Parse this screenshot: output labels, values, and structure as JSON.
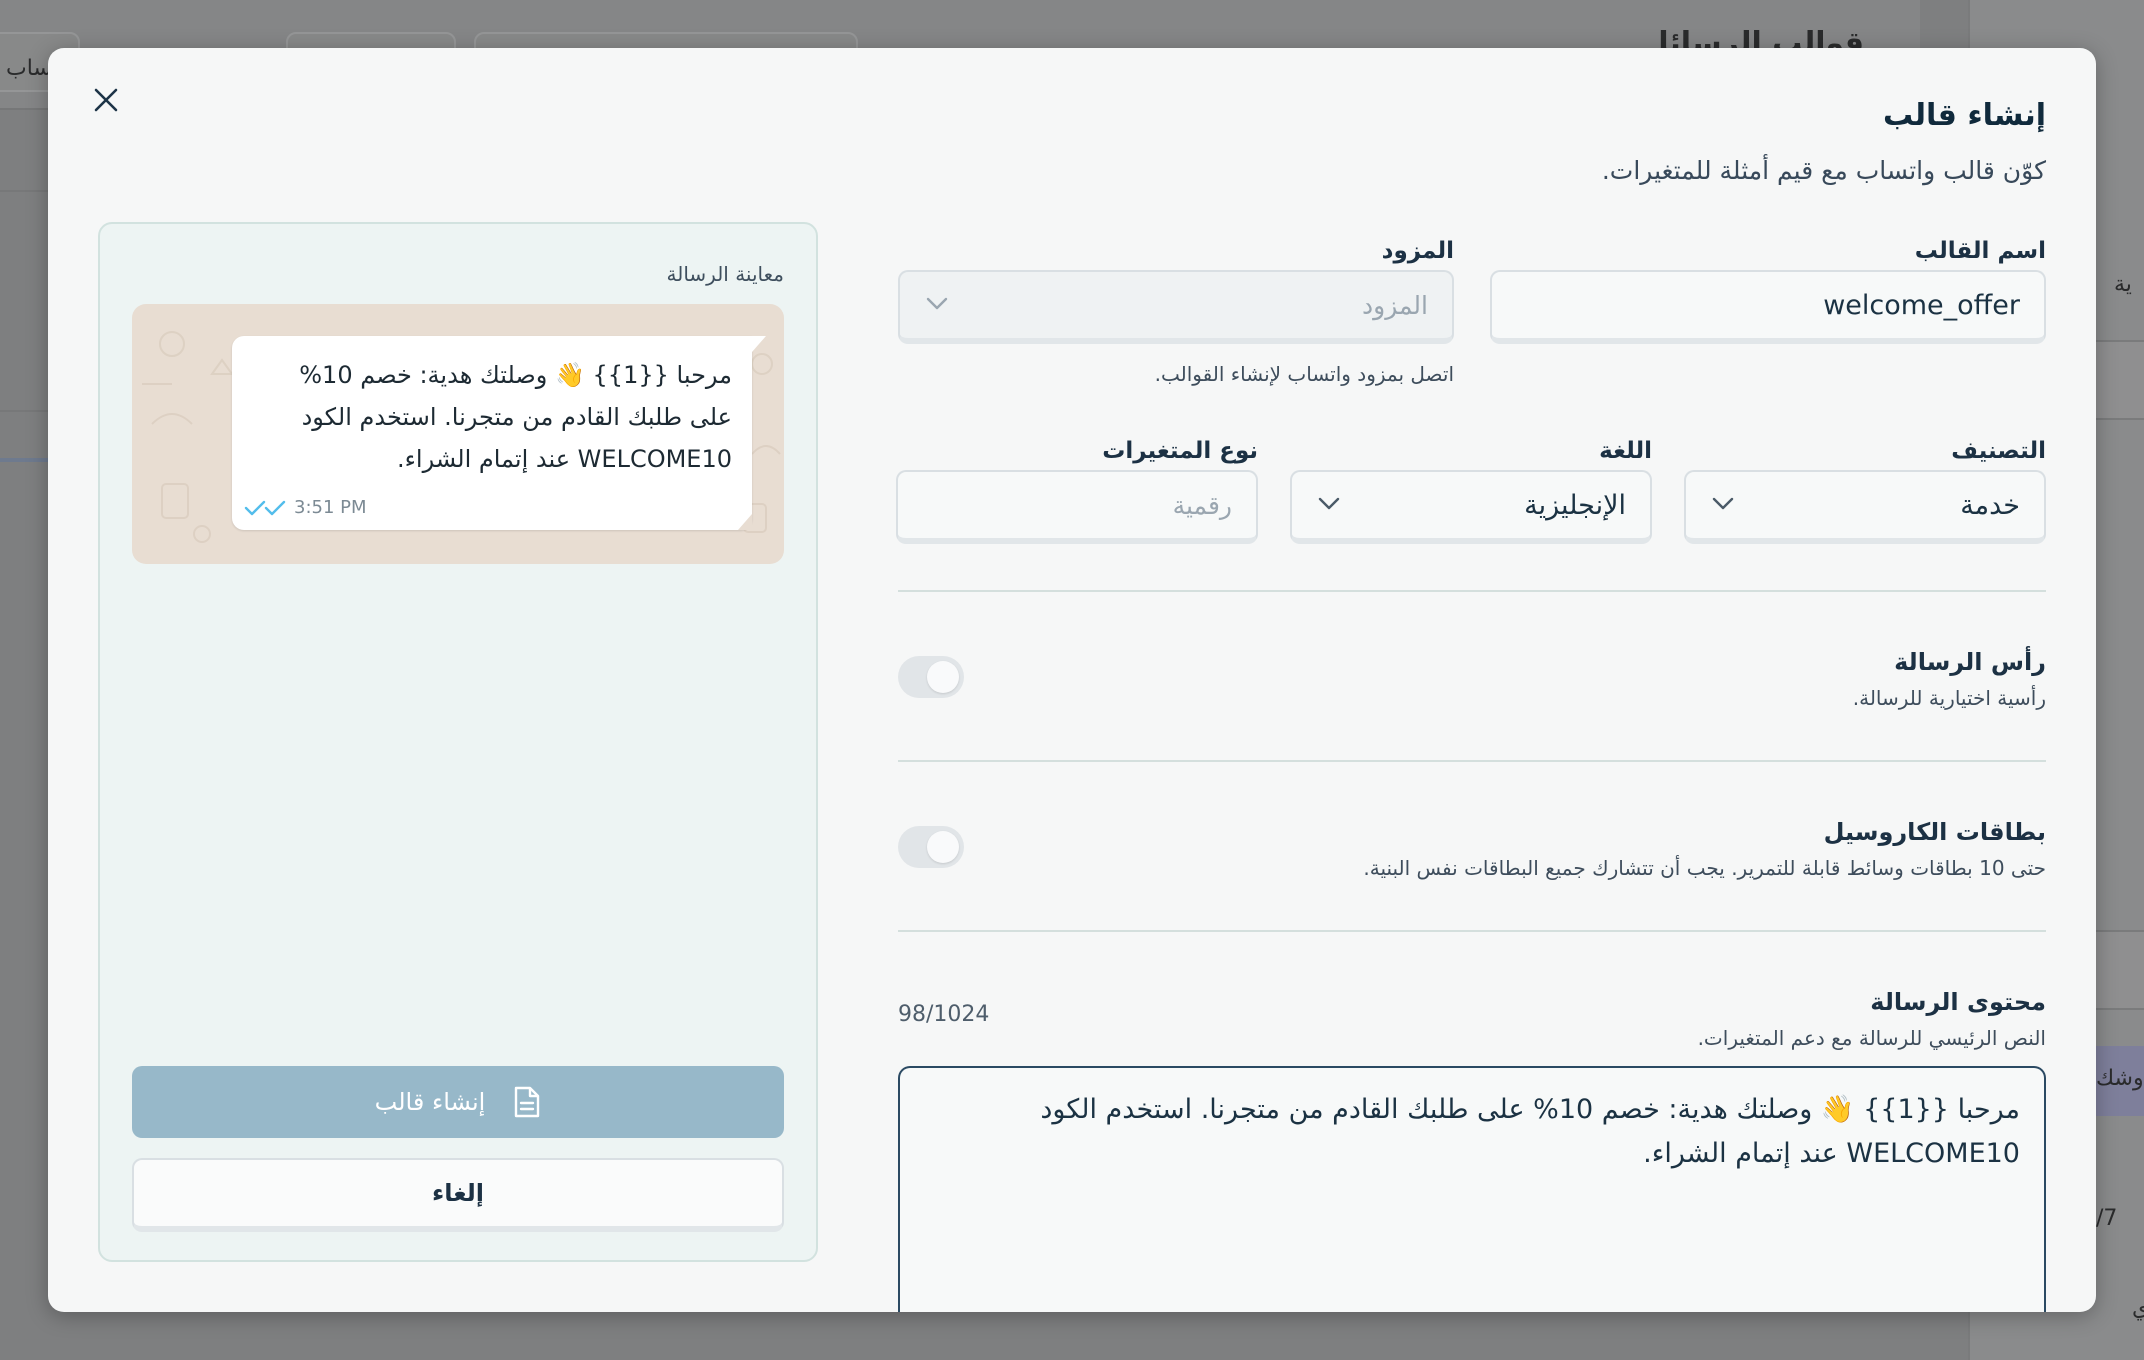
{
  "background": {
    "page_title": "قوالب الرسائل",
    "fragments": [
      "ساب",
      "ية",
      "وشك",
      "/7",
      "ي"
    ]
  },
  "modal": {
    "title": "إنشاء قالب",
    "subtitle": "كوّن قالب واتساب مع قيم أمثلة للمتغيرات."
  },
  "form": {
    "template_name": {
      "label": "اسم القالب",
      "value": "welcome_offer"
    },
    "provider": {
      "label": "المزود",
      "placeholder": "المزود",
      "hint": "اتصل بمزود واتساب لإنشاء القوالب."
    },
    "category": {
      "label": "التصنيف",
      "value": "خدمة"
    },
    "language": {
      "label": "اللغة",
      "value": "الإنجليزية"
    },
    "variable_type": {
      "label": "نوع المتغيرات",
      "placeholder": "رقمية"
    },
    "header": {
      "title": "رأس الرسالة",
      "description": "رأسية اختيارية للرسالة.",
      "enabled": false
    },
    "carousel": {
      "title": "بطاقات الكاروسيل",
      "description": "حتى 10 بطاقات وسائط قابلة للتمرير. يجب أن تتشارك جميع البطاقات نفس البنية.",
      "enabled": false
    },
    "body": {
      "title": "محتوى الرسالة",
      "description": "النص الرئيسي للرسالة مع دعم المتغيرات.",
      "counter": "98/1024",
      "value": "مرحبا {{1}} 👋 وصلتك هدية: خصم 10% على طلبك القادم من متجرنا. استخدم الكود WELCOME10 عند إتمام الشراء."
    }
  },
  "preview": {
    "label": "معاينة الرسالة",
    "message": "مرحبا {{1}} 👋 وصلتك هدية: خصم 10% على طلبك القادم من متجرنا. استخدم الكود WELCOME10 عند إتمام الشراء.",
    "time": "3:51 PM"
  },
  "actions": {
    "create_label": "إنشاء قالب",
    "cancel_label": "إلغاء"
  },
  "colors": {
    "primary_disabled": "#97b8c9",
    "tick": "#53bdeb",
    "chat_background": "#e8ddd2"
  },
  "icons": {
    "close": "close-icon",
    "chevron": "chevron-down-icon",
    "document": "document-icon",
    "double_check": "double-check-icon"
  }
}
